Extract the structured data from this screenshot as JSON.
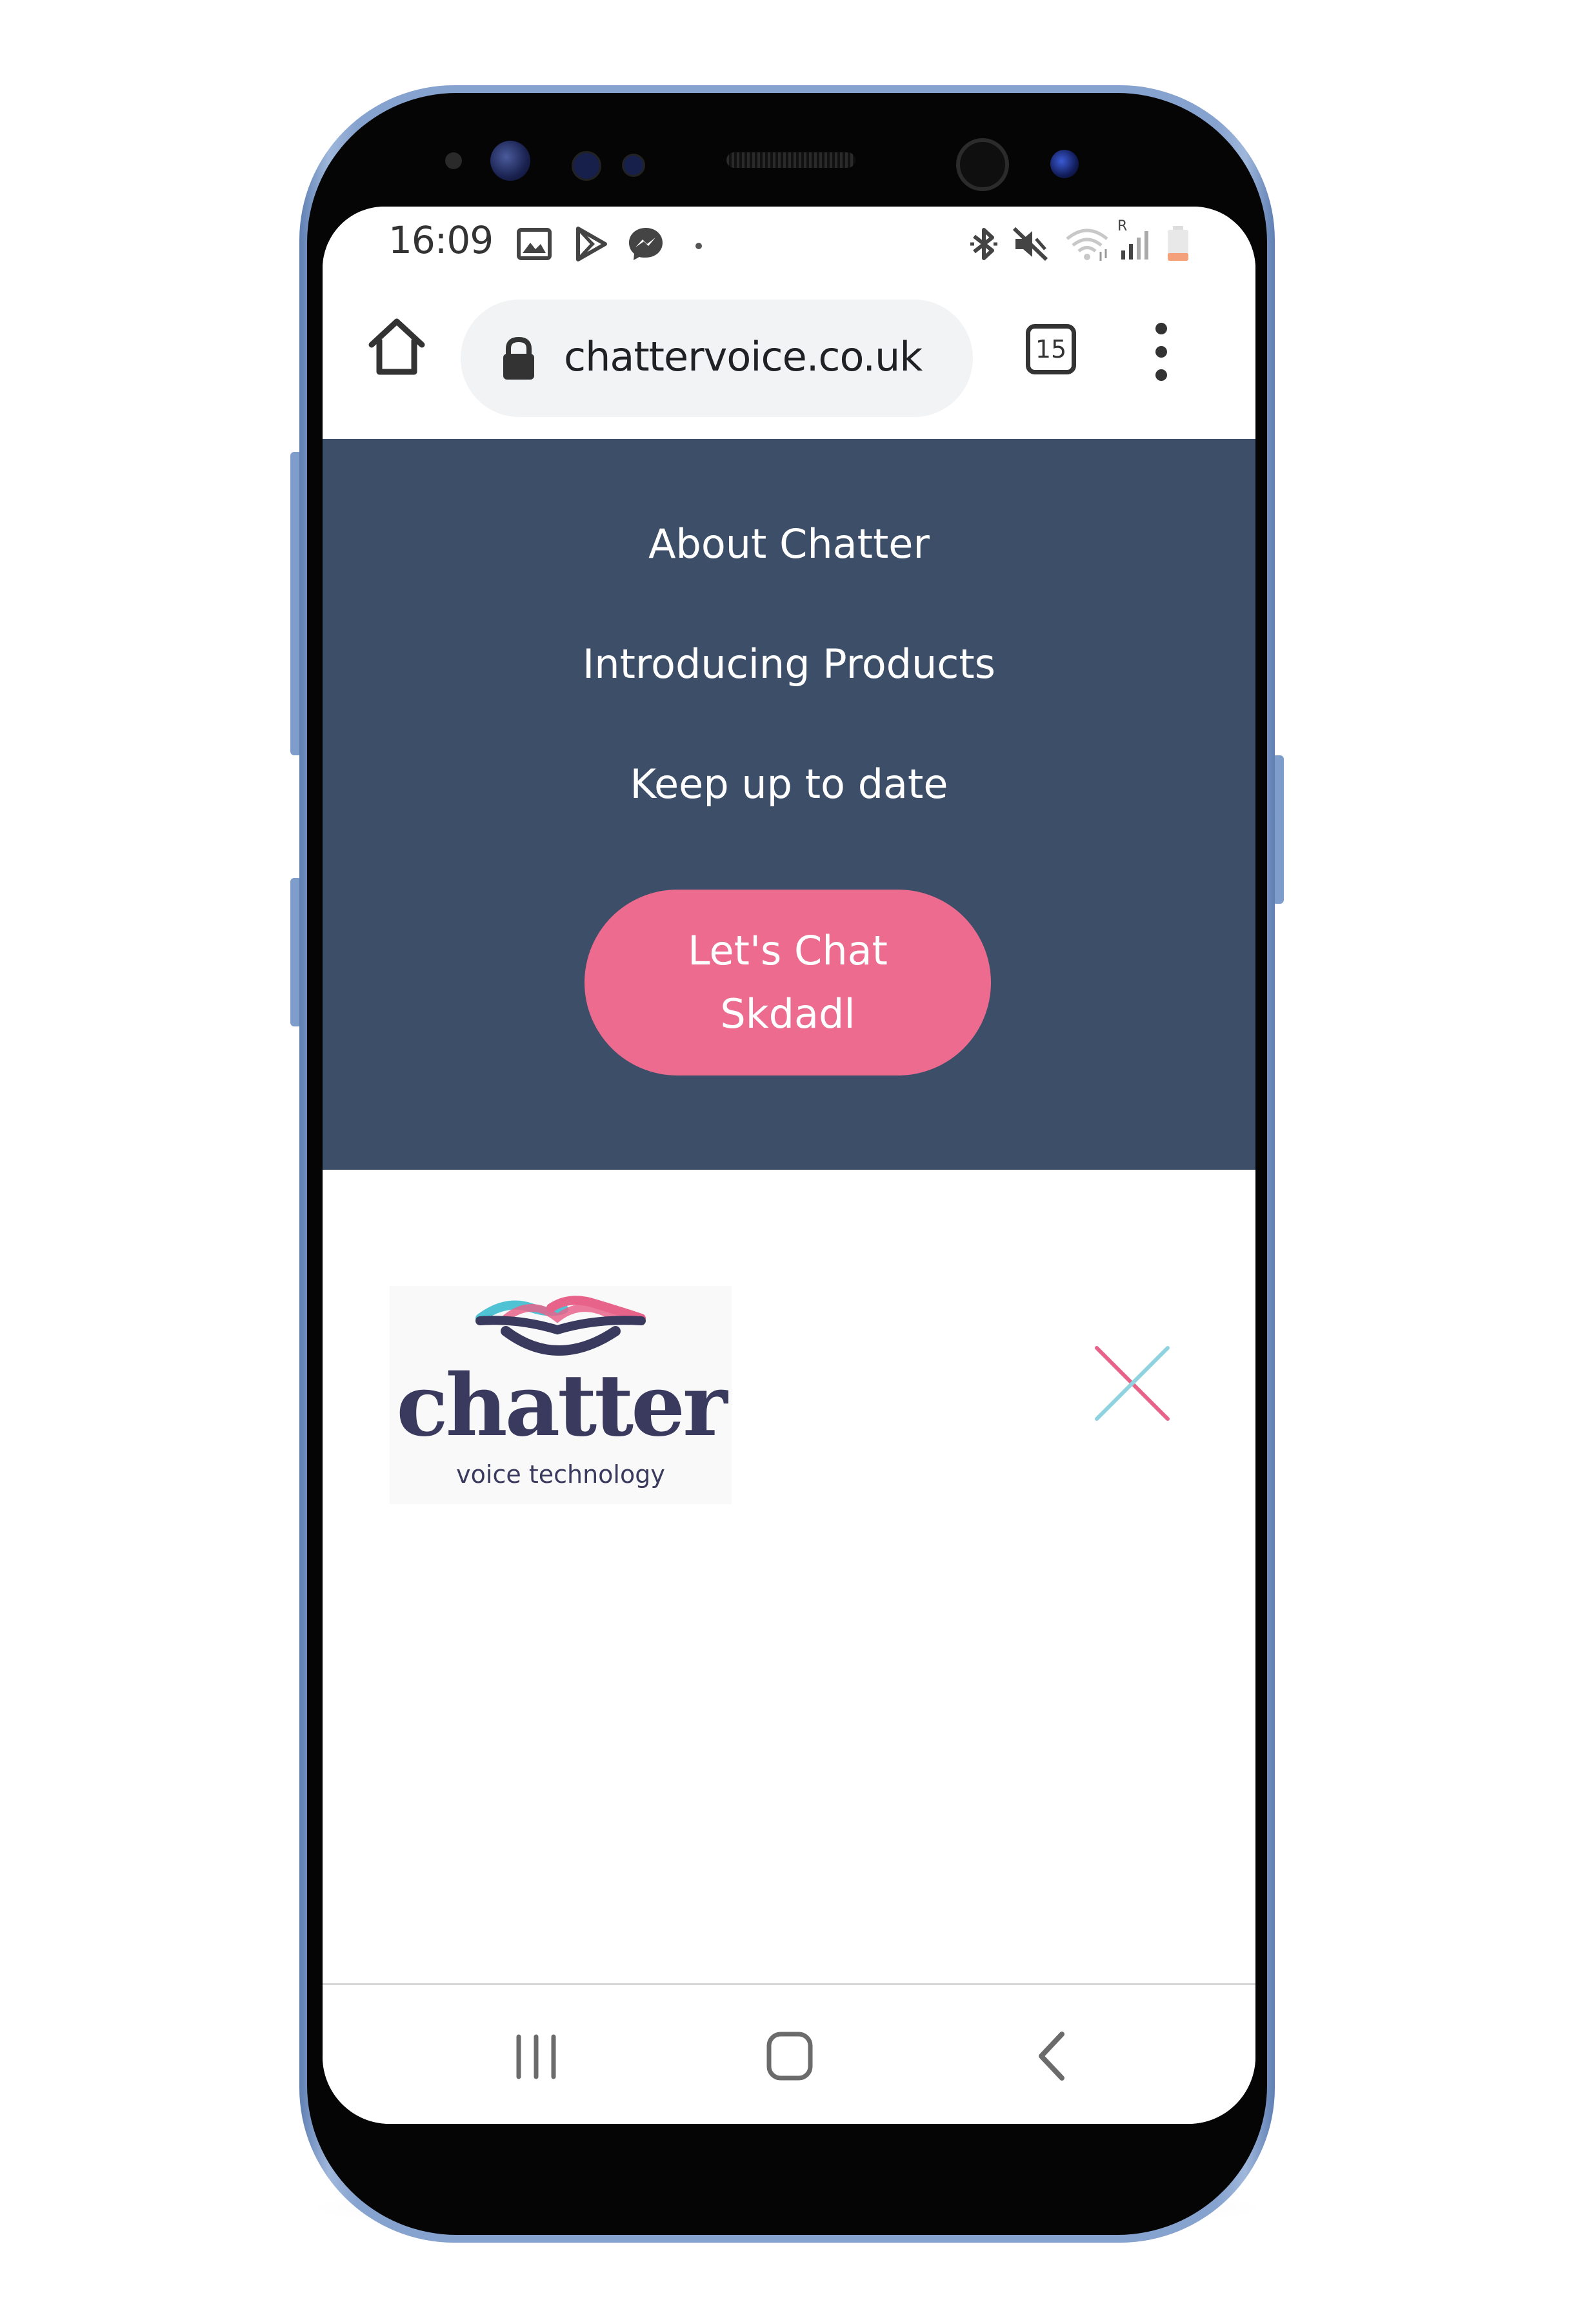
{
  "status_bar": {
    "time": "16:09",
    "left_icons": [
      "image-icon",
      "play-store-icon",
      "messenger-icon",
      "dot-icon"
    ],
    "right_icons": [
      "bluetooth-icon",
      "mute-icon",
      "wifi-icon",
      "signal-icon",
      "battery-icon"
    ],
    "roaming_label": "R"
  },
  "browser": {
    "url": "chattervoice.co.uk",
    "tab_count": "15",
    "home_icon": "home-icon",
    "lock_icon": "lock-icon",
    "menu_icon": "more-vert-icon"
  },
  "nav_menu": {
    "links": [
      "About Chatter",
      "Introducing Products",
      "Keep up to date"
    ],
    "cta_line1": "Let's Chat",
    "cta_line2": "Skdadl"
  },
  "header": {
    "logo_word": "chatter",
    "logo_tagline": "voice technology",
    "close_icon": "close-icon"
  },
  "system_nav": {
    "icons": [
      "recents-icon",
      "home-square-icon",
      "back-icon"
    ]
  },
  "colors": {
    "nav_background": "#3d4f68",
    "cta_pink": "#ec6b8e",
    "logo_navy": "#3a3a5e",
    "logo_teal": "#4fc3d4",
    "logo_pink": "#e8638a",
    "close_pink": "#e8638a",
    "close_blue": "#8fd3e0",
    "phone_frame": "#86a2cf"
  }
}
